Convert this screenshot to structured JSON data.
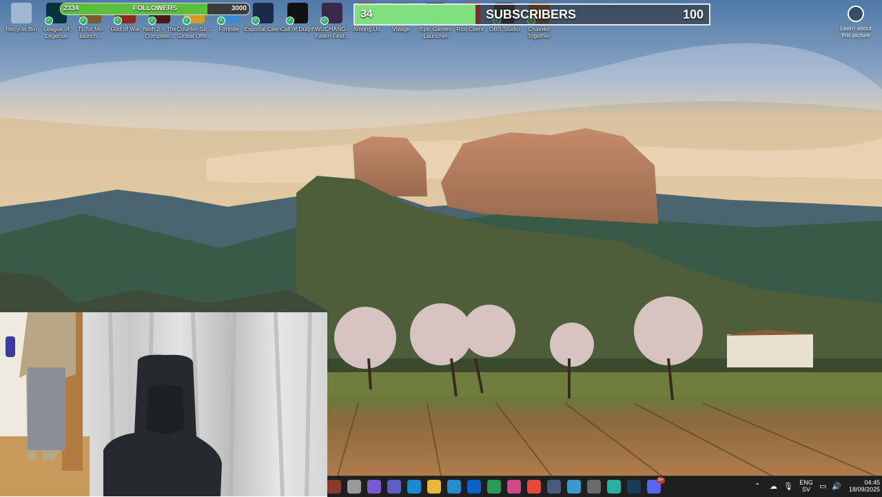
{
  "desktop": {
    "icons": [
      {
        "label": "Recycle Bin",
        "icon": "recycle-bin-icon",
        "color": "#9fb7d0"
      },
      {
        "label": "League of Legends",
        "icon": "league-of-legends-icon",
        "color": "#0a323c"
      },
      {
        "label": "TL for Mc-launch...",
        "icon": "minecraft-launcher-icon",
        "color": "#7a5a2e"
      },
      {
        "label": "God of War",
        "icon": "god-of-war-icon",
        "color": "#8a2a20"
      },
      {
        "label": "Nioh 2 – The Complete...",
        "icon": "nioh2-icon",
        "color": "#4a1a1a"
      },
      {
        "label": "Counter-Str... Global Offe...",
        "icon": "csgo-icon",
        "color": "#d69a2a"
      },
      {
        "label": "Fortnite",
        "icon": "fortnite-icon",
        "color": "#3a8ad0"
      },
      {
        "label": "Esportal Client",
        "icon": "esportal-icon",
        "color": "#1b2a4a"
      },
      {
        "label": "Call of Duty®",
        "icon": "call-of-duty-icon",
        "color": "#111111"
      },
      {
        "label": "WUCHANG - Fallen Feat...",
        "icon": "wuchang-icon",
        "color": "#3a2a4a"
      },
      {
        "label": "Among Us",
        "icon": "among-us-icon",
        "color": "#c0292b"
      },
      {
        "label": "Visage",
        "icon": "visage-icon",
        "color": "#5a5a5a"
      },
      {
        "label": "Epic Games Launcher",
        "icon": "epic-games-icon",
        "color": "#2a2a2a"
      },
      {
        "label": "Riot Client",
        "icon": "riot-client-icon",
        "color": "#d13639"
      },
      {
        "label": "OBS Studio",
        "icon": "obs-studio-icon",
        "color": "#302e31"
      },
      {
        "label": "Chained Together",
        "icon": "chained-together-icon",
        "color": "#7a4a2a"
      }
    ]
  },
  "followers": {
    "label": "FOLLOWERS",
    "current": "2334",
    "goal": "3000",
    "progress": 0.778
  },
  "subscribers": {
    "label": "SUBSCRIBERS",
    "current": "34",
    "goal": "100",
    "progress": 0.34
  },
  "learn": {
    "label": "Learn about this picture",
    "icon": "camera-icon"
  },
  "taskbar": {
    "apps": [
      {
        "name": "start-icon",
        "color": "#8a3a2a"
      },
      {
        "name": "task-view-icon",
        "color": "#9a9a9a"
      },
      {
        "name": "copilot-icon",
        "color": "#7a5ad0"
      },
      {
        "name": "teams-icon",
        "color": "#5b5fc7"
      },
      {
        "name": "edge-icon",
        "color": "#1a8ad0"
      },
      {
        "name": "file-explorer-icon",
        "color": "#e8b83a"
      },
      {
        "name": "microsoft-store-icon",
        "color": "#2a8ad0"
      },
      {
        "name": "outlook-icon",
        "color": "#0a64c8"
      },
      {
        "name": "security-icon",
        "color": "#2a9a5a"
      },
      {
        "name": "m365-icon",
        "color": "#d04a8a"
      },
      {
        "name": "chrome-icon",
        "color": "#e34a3a"
      },
      {
        "name": "app-cube-icon",
        "color": "#4a5a7a"
      },
      {
        "name": "photos-icon",
        "color": "#3a9ad0"
      },
      {
        "name": "steam-alt-icon",
        "color": "#6a6a6a"
      },
      {
        "name": "app-circle-icon",
        "color": "#2ab0a0"
      },
      {
        "name": "steam-icon",
        "color": "#1b3a5a"
      },
      {
        "name": "discord-icon",
        "color": "#5865f2"
      }
    ],
    "discord_badge": "9+",
    "language": "ENG",
    "region": "SV",
    "time": "04:45",
    "date": "18/09/2025"
  }
}
